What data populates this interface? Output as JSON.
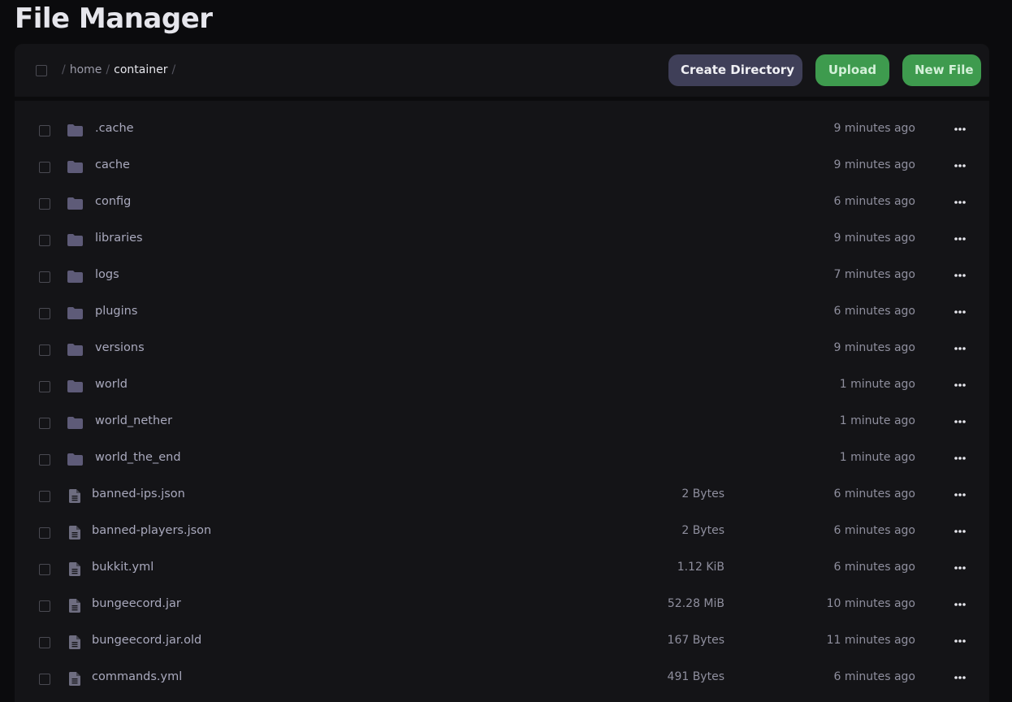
{
  "page": {
    "title": "File Manager"
  },
  "breadcrumb": {
    "separator": "/",
    "segments": [
      {
        "label": "home",
        "current": false
      },
      {
        "label": "container",
        "current": true
      }
    ]
  },
  "toolbar": {
    "create_directory_label": "Create Directory",
    "upload_label": "Upload",
    "new_file_label": "New File"
  },
  "colors": {
    "background": "#0b0b0d",
    "panel": "#141417",
    "folder_icon": "#5e5b78",
    "file_icon": "#6e6d80",
    "button_secondary": "#3f3f58",
    "button_primary": "#3e9b4e"
  },
  "files": [
    {
      "name": ".cache",
      "type": "folder",
      "icon": "folder-icon",
      "size": "",
      "modified": "9 minutes ago"
    },
    {
      "name": "cache",
      "type": "folder",
      "icon": "folder-icon",
      "size": "",
      "modified": "9 minutes ago"
    },
    {
      "name": "config",
      "type": "folder",
      "icon": "folder-icon",
      "size": "",
      "modified": "6 minutes ago"
    },
    {
      "name": "libraries",
      "type": "folder",
      "icon": "folder-icon",
      "size": "",
      "modified": "9 minutes ago"
    },
    {
      "name": "logs",
      "type": "folder",
      "icon": "folder-icon",
      "size": "",
      "modified": "7 minutes ago"
    },
    {
      "name": "plugins",
      "type": "folder",
      "icon": "folder-icon",
      "size": "",
      "modified": "6 minutes ago"
    },
    {
      "name": "versions",
      "type": "folder",
      "icon": "folder-icon",
      "size": "",
      "modified": "9 minutes ago"
    },
    {
      "name": "world",
      "type": "folder",
      "icon": "folder-icon",
      "size": "",
      "modified": "1 minute ago"
    },
    {
      "name": "world_nether",
      "type": "folder",
      "icon": "folder-icon",
      "size": "",
      "modified": "1 minute ago"
    },
    {
      "name": "world_the_end",
      "type": "folder",
      "icon": "folder-icon",
      "size": "",
      "modified": "1 minute ago"
    },
    {
      "name": "banned-ips.json",
      "type": "file",
      "icon": "file-icon",
      "size": "2 Bytes",
      "modified": "6 minutes ago"
    },
    {
      "name": "banned-players.json",
      "type": "file",
      "icon": "file-icon",
      "size": "2 Bytes",
      "modified": "6 minutes ago"
    },
    {
      "name": "bukkit.yml",
      "type": "file",
      "icon": "file-icon",
      "size": "1.12 KiB",
      "modified": "6 minutes ago"
    },
    {
      "name": "bungeecord.jar",
      "type": "file",
      "icon": "file-icon",
      "size": "52.28 MiB",
      "modified": "10 minutes ago"
    },
    {
      "name": "bungeecord.jar.old",
      "type": "file",
      "icon": "file-icon",
      "size": "167 Bytes",
      "modified": "11 minutes ago"
    },
    {
      "name": "commands.yml",
      "type": "file",
      "icon": "file-icon",
      "size": "491 Bytes",
      "modified": "6 minutes ago"
    }
  ]
}
